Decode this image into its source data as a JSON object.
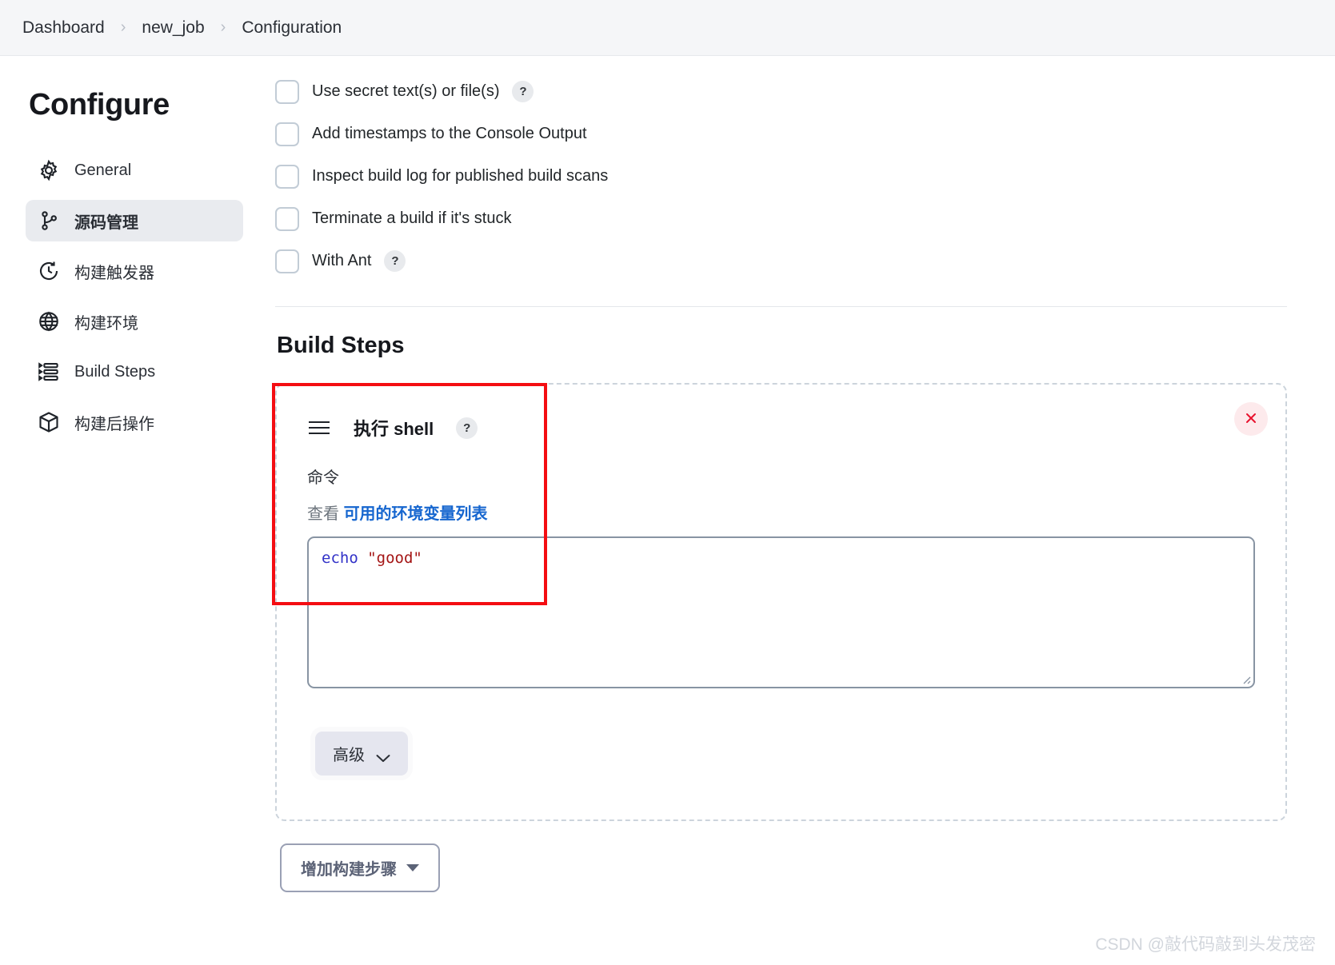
{
  "breadcrumb": {
    "items": [
      "Dashboard",
      "new_job",
      "Configuration"
    ],
    "separator": "›"
  },
  "sidebar": {
    "title": "Configure",
    "items": [
      {
        "label": "General",
        "icon": "gear-icon",
        "active": false
      },
      {
        "label": "源码管理",
        "icon": "source-branch-icon",
        "active": true
      },
      {
        "label": "构建触发器",
        "icon": "clock-icon",
        "active": false
      },
      {
        "label": "构建环境",
        "icon": "globe-icon",
        "active": false
      },
      {
        "label": "Build Steps",
        "icon": "list-steps-icon",
        "active": false
      },
      {
        "label": "构建后操作",
        "icon": "package-icon",
        "active": false
      }
    ]
  },
  "checkboxes": [
    {
      "label": "Use secret text(s) or file(s)",
      "checked": false,
      "help": "?"
    },
    {
      "label": "Add timestamps to the Console Output",
      "checked": false,
      "help": ""
    },
    {
      "label": "Inspect build log for published build scans",
      "checked": false,
      "help": ""
    },
    {
      "label": "Terminate a build if it's stuck",
      "checked": false,
      "help": ""
    },
    {
      "label": "With Ant",
      "checked": false,
      "help": "?"
    }
  ],
  "build_steps": {
    "heading": "Build Steps",
    "step": {
      "title": "执行 shell",
      "help": "?",
      "command_label": "命令",
      "env_prefix": "查看",
      "env_link": "可用的环境变量列表",
      "code": {
        "command": "echo",
        "argument": "\"good\""
      },
      "advanced_label": "高级",
      "close_title": "×"
    },
    "add_step_label": "增加构建步骤"
  },
  "watermark": "CSDN @敲代码敲到头发茂密",
  "colors": {
    "accent_link": "#1666cf",
    "annotation": "#f40d12",
    "close_icon": "#e8122e",
    "close_bg": "#fdeaec",
    "code_command": "#3232c8",
    "code_string": "#a41515",
    "active_nav_bg": "#e9ebef"
  }
}
